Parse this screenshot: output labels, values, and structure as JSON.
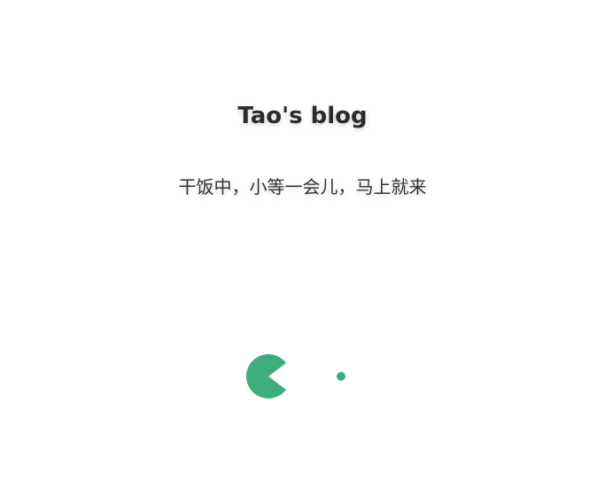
{
  "page": {
    "title": "Tao's blog",
    "message": "干饭中，小等一会儿，马上就来"
  },
  "loader": {
    "color": "#3eaf7c"
  }
}
